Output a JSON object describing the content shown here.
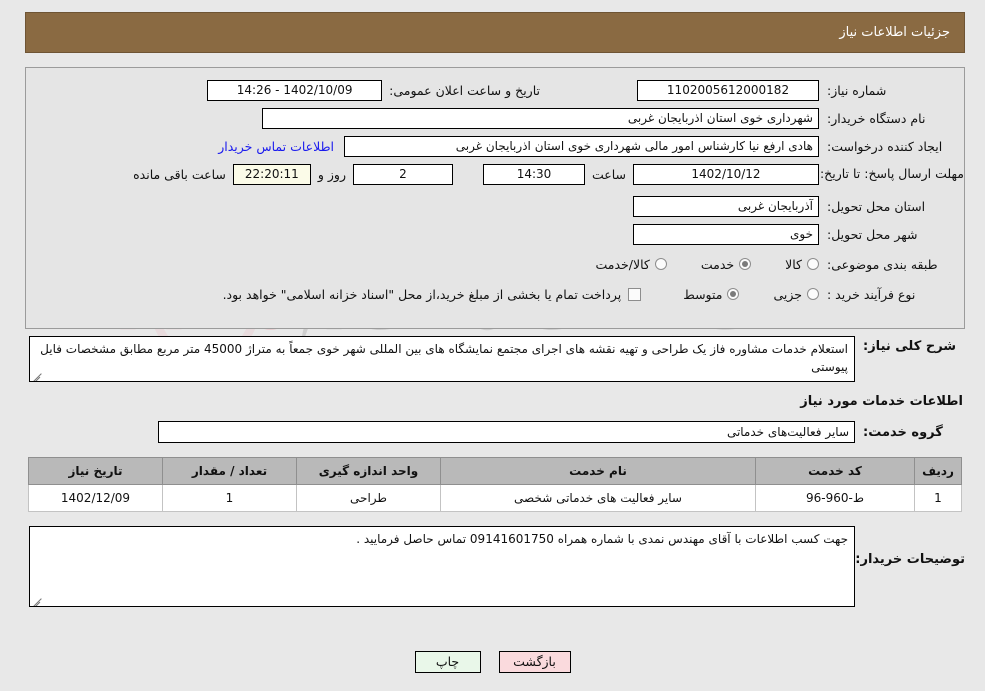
{
  "header": {
    "title": "جزئیات اطلاعات نیاز"
  },
  "info": {
    "need_number_label": "شماره نیاز:",
    "need_number_value": "1102005612000182",
    "public_announce_label": "تاریخ و ساعت اعلان عمومی:",
    "public_announce_value": "1402/10/09 - 14:26",
    "buyer_org_label": "نام دستگاه خریدار:",
    "buyer_org_value": "شهرداری خوی استان اذربایجان غربی",
    "requester_label": "ایجاد کننده درخواست:",
    "requester_value": "هادی ارفع نیا کارشناس امور مالی شهرداری خوی استان اذربایجان غربی",
    "buyer_contact_link": "اطلاعات تماس خریدار",
    "deadline_label": "مهلت ارسال پاسخ: تا تاریخ:",
    "deadline_date": "1402/10/12",
    "time_label": "ساعت",
    "deadline_time": "14:30",
    "days_remaining": "2",
    "days_label": "روز و",
    "hours_remaining": "22:20:11",
    "hours_label": "ساعت باقی مانده",
    "province_label": "استان محل تحویل:",
    "province_value": "آذربایجان غربی",
    "city_label": "شهر محل تحویل:",
    "city_value": "خوی",
    "category_label": "طبقه بندی موضوعی:",
    "category_options": [
      {
        "label": "کالا",
        "selected": false
      },
      {
        "label": "خدمت",
        "selected": true
      },
      {
        "label": "کالا/خدمت",
        "selected": false
      }
    ],
    "purchase_type_label": "نوع فرآیند خرید :",
    "purchase_type_options": [
      {
        "label": "جزیی",
        "selected": false
      },
      {
        "label": "متوسط",
        "selected": true
      }
    ],
    "treasury_checkbox_label": "پرداخت تمام یا بخشی از مبلغ خرید،از محل \"اسناد خزانه اسلامی\" خواهد بود.",
    "treasury_checked": false
  },
  "description": {
    "label": "شرح کلی نیاز:",
    "text": "استعلام خدمات مشاوره فاز یک طراحی و تهیه نقشه های اجرای مجتمع نمایشگاه های بین المللی شهر خوی جمعاً به متراژ 45000 متر مربع مطابق مشخصات فایل پیوستی"
  },
  "services": {
    "heading": "اطلاعات خدمات مورد نیاز",
    "group_label": "گروه خدمت:",
    "group_value": "سایر فعالیت‌های خدماتی",
    "columns": [
      "ردیف",
      "کد خدمت",
      "نام خدمت",
      "واحد اندازه گیری",
      "تعداد / مقدار",
      "تاریخ نیاز"
    ],
    "rows": [
      {
        "index": "1",
        "code": "ط-960-96",
        "name": "سایر فعالیت های خدماتی شخصی",
        "unit": "طراحی",
        "quantity": "1",
        "need_date": "1402/12/09"
      }
    ]
  },
  "buyer_notes": {
    "label": "توضیحات خریدار:",
    "text": "جهت کسب اطلاعات با آقای مهندس نمدی با شماره همراه 09141601750 تماس حاصل فرمایید ."
  },
  "footer": {
    "print_label": "چاپ",
    "back_label": "بازگشت"
  },
  "watermark": {
    "text_left": "Aria",
    "text_right": "Tender",
    "suffix": ".net"
  },
  "colors": {
    "header_bg": "#8a6a42",
    "panel_bg": "#e5e5e5",
    "page_bg": "#e8e8e8",
    "link": "#1a1aee",
    "table_header_bg": "#b9b9b9",
    "print_btn": "#e9f7e9",
    "back_btn": "#fadadd",
    "highlight_field": "#fbfbe8"
  }
}
